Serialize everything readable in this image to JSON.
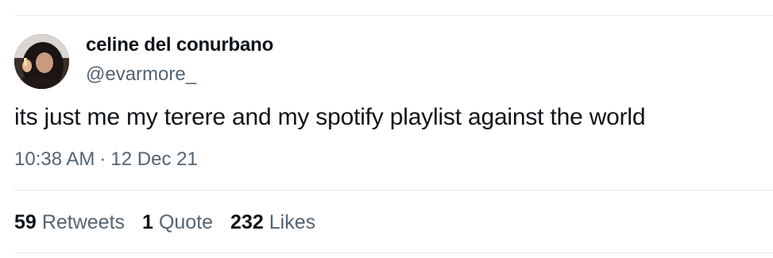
{
  "tweet": {
    "display_name": "celine del conurbano",
    "handle": "@evarmore_",
    "text": "its just me my terere and my spotify playlist against the world",
    "time": "10:38 AM",
    "separator": "·",
    "date": "12 Dec 21"
  },
  "stats": {
    "retweets": {
      "count": "59",
      "label": "Retweets"
    },
    "quotes": {
      "count": "1",
      "label": "Quote"
    },
    "likes": {
      "count": "232",
      "label": "Likes"
    }
  },
  "colors": {
    "primary_text": "#0f1419",
    "secondary_text": "#536471",
    "divider": "#e6e9eb"
  },
  "icons": {
    "avatar": "profile-photo"
  }
}
